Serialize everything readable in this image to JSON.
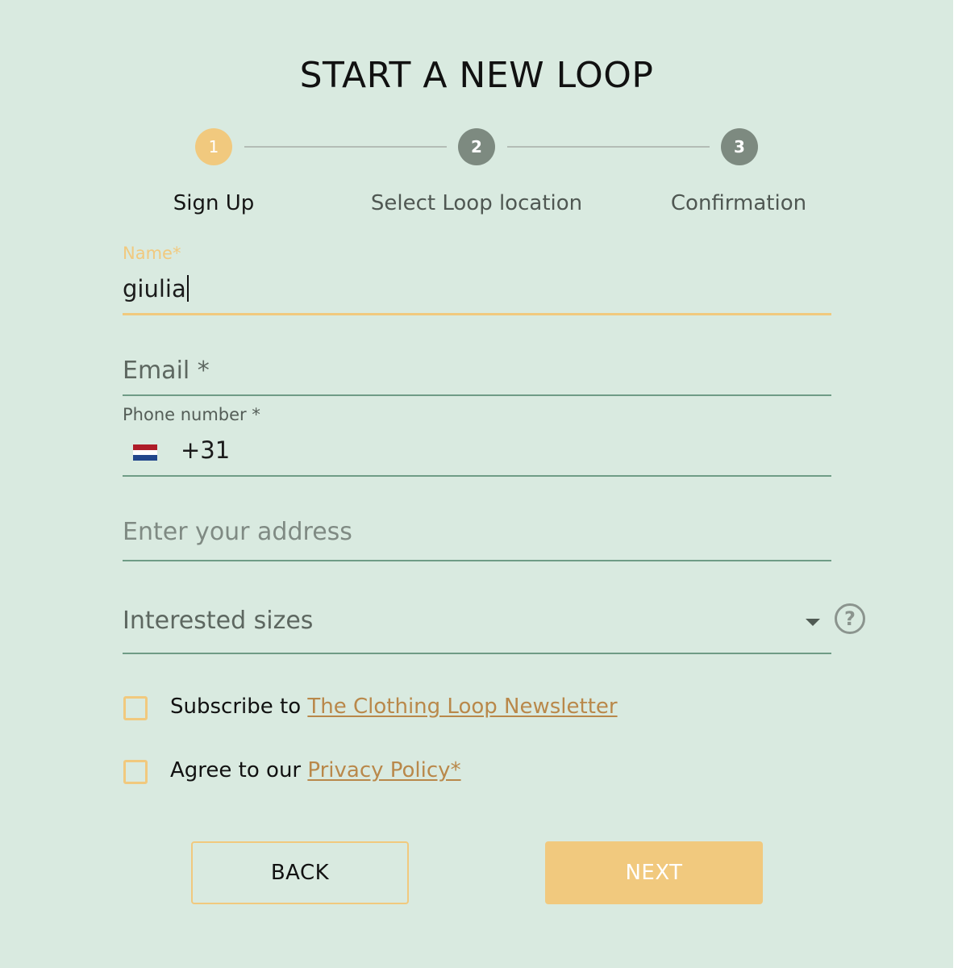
{
  "title": "START A NEW LOOP",
  "stepper": {
    "steps": [
      {
        "number": "1",
        "label": "Sign Up",
        "state": "active"
      },
      {
        "number": "2",
        "label": "Select Loop location",
        "state": "inactive"
      },
      {
        "number": "3",
        "label": "Confirmation",
        "state": "inactive"
      }
    ]
  },
  "form": {
    "name": {
      "label": "Name*",
      "value": "giulia"
    },
    "email": {
      "placeholder": "Email *"
    },
    "phone": {
      "label": "Phone number *",
      "prefix": "+31",
      "flag_icon": "netherlands-flag-icon"
    },
    "address": {
      "placeholder": "Enter your address"
    },
    "sizes": {
      "placeholder": "Interested sizes",
      "help_icon": "question-circle-icon"
    },
    "newsletter": {
      "prefix": "Subscribe to ",
      "link": "The Clothing Loop Newsletter",
      "checked": false
    },
    "privacy": {
      "prefix": "Agree to our ",
      "link": "Privacy Policy*",
      "checked": false
    }
  },
  "buttons": {
    "back": "BACK",
    "next": "NEXT"
  },
  "colors": {
    "background": "#d9eae0",
    "accent": "#f1c97e",
    "link": "#b9884a",
    "inactive_step": "#7d8a80",
    "underline": "#6f9c86"
  }
}
